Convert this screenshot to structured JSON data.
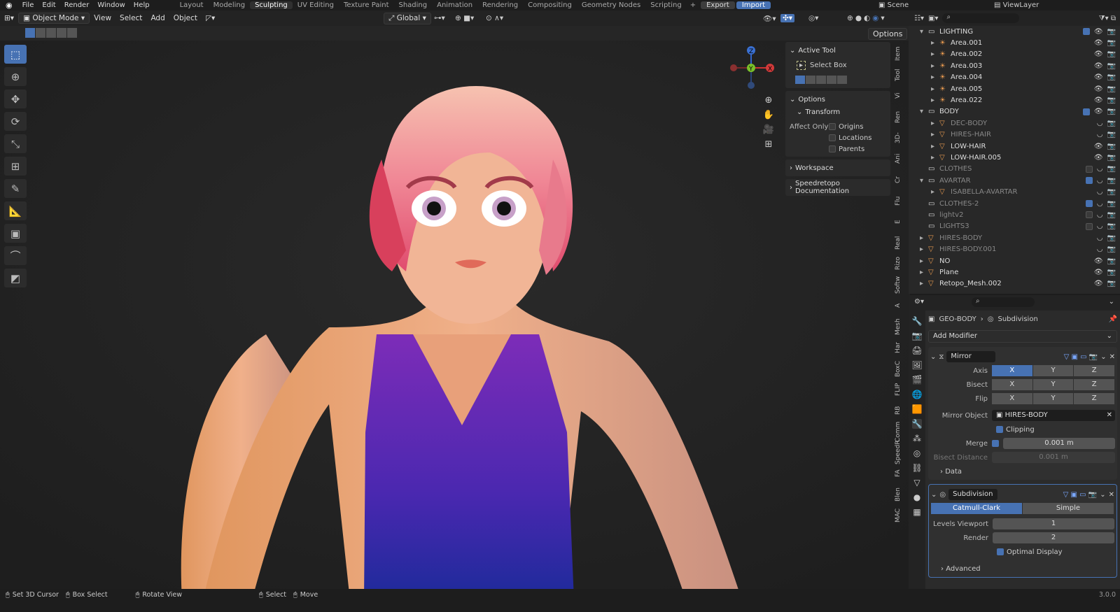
{
  "menu": [
    "File",
    "Edit",
    "Render",
    "Window",
    "Help"
  ],
  "workspaces": [
    "Layout",
    "Modeling",
    "Sculpting",
    "UV Editing",
    "Texture Paint",
    "Shading",
    "Animation",
    "Rendering",
    "Compositing",
    "Geometry Nodes",
    "Scripting"
  ],
  "active_workspace": "Sculpting",
  "export_label": "Export",
  "import_label": "Import",
  "scene_label": "Scene",
  "viewlayer_label": "ViewLayer",
  "viewport_header": {
    "mode": "Object Mode",
    "view": "View",
    "select": "Select",
    "add": "Add",
    "object": "Object",
    "transform": "Global",
    "options": "Options"
  },
  "npanel": {
    "active_tool_title": "Active Tool",
    "tool_name": "Select Box",
    "options_title": "Options",
    "transform_title": "Transform",
    "affect_only": "Affect Only",
    "origins": "Origins",
    "locations": "Locations",
    "parents": "Parents",
    "workspace_title": "Workspace",
    "speedretopo_title": "Speedretopo Documentation"
  },
  "side_tabs": [
    "Item",
    "Tool",
    "Vi",
    "Ren",
    "3D-",
    "Ani",
    "Cr",
    "Flu",
    "E",
    "Real",
    "Rizo",
    "Softw",
    "A",
    "Mesh",
    "Har",
    "BoxC",
    "FLIP",
    "RB",
    "Comm",
    "SpeedR",
    "FA",
    "Blen",
    "MAC"
  ],
  "gizmo": {
    "x": "X",
    "y": "Y",
    "z": "Z"
  },
  "outliner": [
    {
      "name": "LIGHTING",
      "indent": 1,
      "type": "collection",
      "expand": "open",
      "check": true,
      "dim": false
    },
    {
      "name": "Area.001",
      "indent": 2,
      "type": "light",
      "expand": "closed",
      "dim": false
    },
    {
      "name": "Area.002",
      "indent": 2,
      "type": "light",
      "expand": "closed",
      "dim": false
    },
    {
      "name": "Area.003",
      "indent": 2,
      "type": "light",
      "expand": "closed",
      "dim": false
    },
    {
      "name": "Area.004",
      "indent": 2,
      "type": "light",
      "expand": "closed",
      "dim": false
    },
    {
      "name": "Area.005",
      "indent": 2,
      "type": "light",
      "expand": "closed",
      "dim": false
    },
    {
      "name": "Area.022",
      "indent": 2,
      "type": "light",
      "expand": "closed",
      "dim": false
    },
    {
      "name": "BODY",
      "indent": 1,
      "type": "collection",
      "expand": "open",
      "check": true,
      "dim": false
    },
    {
      "name": "DEC-BODY",
      "indent": 2,
      "type": "mesh",
      "expand": "closed",
      "dim": true
    },
    {
      "name": "HIRES-HAIR",
      "indent": 2,
      "type": "mesh",
      "expand": "closed",
      "dim": true
    },
    {
      "name": "LOW-HAIR",
      "indent": 2,
      "type": "mesh",
      "expand": "closed",
      "dim": false
    },
    {
      "name": "LOW-HAIR.005",
      "indent": 2,
      "type": "mesh",
      "expand": "closed",
      "dim": false
    },
    {
      "name": "CLOTHES",
      "indent": 1,
      "type": "collection",
      "expand": "none",
      "check": false,
      "dim": true
    },
    {
      "name": "AVARTAR",
      "indent": 1,
      "type": "collection",
      "expand": "open",
      "check": true,
      "dim": true
    },
    {
      "name": "ISABELLA-AVARTAR",
      "indent": 2,
      "type": "mesh",
      "expand": "closed",
      "dim": true
    },
    {
      "name": "CLOTHES-2",
      "indent": 1,
      "type": "collection",
      "expand": "none",
      "check": true,
      "dim": true
    },
    {
      "name": "lightv2",
      "indent": 1,
      "type": "collection",
      "expand": "none",
      "check": false,
      "dim": true
    },
    {
      "name": "LIGHTS3",
      "indent": 1,
      "type": "collection",
      "expand": "none",
      "check": false,
      "dim": true
    },
    {
      "name": "HIRES-BODY",
      "indent": 1,
      "type": "mesh",
      "expand": "closed",
      "dim": true
    },
    {
      "name": "HIRES-BODY.001",
      "indent": 1,
      "type": "mesh",
      "expand": "closed",
      "dim": true
    },
    {
      "name": "NO",
      "indent": 1,
      "type": "mesh",
      "expand": "closed",
      "dim": false
    },
    {
      "name": "Plane",
      "indent": 1,
      "type": "mesh",
      "expand": "closed",
      "dim": false
    },
    {
      "name": "Retopo_Mesh.002",
      "indent": 1,
      "type": "mesh",
      "expand": "closed",
      "dim": false
    }
  ],
  "props": {
    "object_name": "GEO-BODY",
    "modifier_path": "Subdivision",
    "add_modifier": "Add Modifier",
    "mirror": {
      "name": "Mirror",
      "axis_label": "Axis",
      "bisect_label": "Bisect",
      "flip_label": "Flip",
      "axes": [
        "X",
        "Y",
        "Z"
      ],
      "mirror_object_label": "Mirror Object",
      "mirror_object": "HIRES-BODY",
      "clipping": "Clipping",
      "merge_label": "Merge",
      "merge_value": "0.001 m",
      "bisect_distance_label": "Bisect Distance",
      "bisect_distance_value": "0.001 m",
      "data_label": "Data"
    },
    "subdiv": {
      "name": "Subdivision",
      "catmull": "Catmull-Clark",
      "simple": "Simple",
      "levels_viewport_label": "Levels Viewport",
      "levels_viewport": "1",
      "render_label": "Render",
      "render_value": "2",
      "optimal_display": "Optimal Display",
      "advanced": "Advanced"
    }
  },
  "status": {
    "set_cursor": "Set 3D Cursor",
    "box_select": "Box Select",
    "rotate_view": "Rotate View",
    "select": "Select",
    "move": "Move",
    "version": "3.0.0"
  }
}
